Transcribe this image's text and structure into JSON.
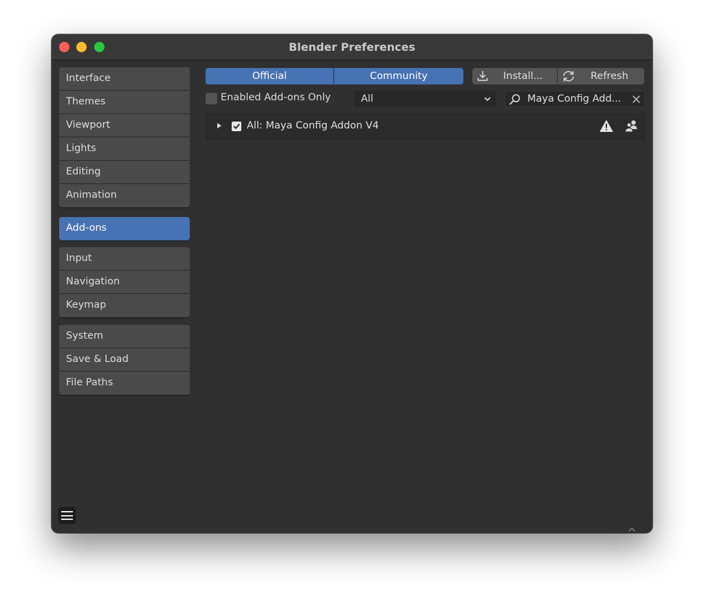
{
  "window": {
    "title": "Blender Preferences"
  },
  "sidebar": {
    "groups": [
      [
        "Interface",
        "Themes",
        "Viewport",
        "Lights",
        "Editing",
        "Animation"
      ],
      [
        "Add-ons"
      ],
      [
        "Input",
        "Navigation",
        "Keymap"
      ],
      [
        "System",
        "Save & Load",
        "File Paths"
      ]
    ],
    "active": "Add-ons"
  },
  "toolbar": {
    "official_label": "Official",
    "community_label": "Community",
    "install_label": "Install...",
    "refresh_label": "Refresh"
  },
  "filters": {
    "enabled_only_label": "Enabled Add-ons Only",
    "enabled_only_checked": false,
    "category_value": "All",
    "search_value": "Maya Config Add..."
  },
  "addons": [
    {
      "name": "All: Maya Config Addon V4",
      "enabled": true,
      "icons": [
        "warning-icon",
        "community-icon"
      ]
    }
  ],
  "colors": {
    "accent": "#4772b3",
    "window_bg": "#303030",
    "button_bg": "#545454",
    "field_bg": "#282828"
  },
  "icons": [
    "download-icon",
    "refresh-icon",
    "search-icon",
    "clear-icon",
    "chevron-down-icon",
    "expand-arrow-icon",
    "checkbox-check-icon",
    "warning-icon",
    "community-icon",
    "hamburger-menu-icon"
  ]
}
